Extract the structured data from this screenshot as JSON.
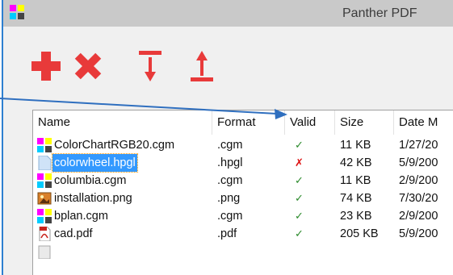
{
  "window": {
    "title": "Panther PDF"
  },
  "toolbar": {
    "buttons": [
      {
        "name": "add",
        "icon": "plus-icon"
      },
      {
        "name": "delete",
        "icon": "x-icon"
      },
      {
        "name": "move-bottom",
        "icon": "arrow-down-to-line-icon"
      },
      {
        "name": "move-top",
        "icon": "arrow-up-from-line-icon"
      }
    ],
    "accent_color": "#e83a3a"
  },
  "table": {
    "columns": [
      "Name",
      "Format",
      "Valid",
      "Size",
      "Date M"
    ],
    "rows": [
      {
        "name": "ColorChartRGB20.cgm",
        "format": ".cgm",
        "valid": "✓",
        "size": "11 KB",
        "date": "1/27/20",
        "icon": "cgm-file-icon",
        "selected": false
      },
      {
        "name": "colorwheel.hpgl",
        "format": ".hpgl",
        "valid": "✗",
        "size": "42 KB",
        "date": "5/9/200",
        "icon": "hpgl-file-icon",
        "selected": true
      },
      {
        "name": "columbia.cgm",
        "format": ".cgm",
        "valid": "✓",
        "size": "11 KB",
        "date": "2/9/200",
        "icon": "cgm-file-icon",
        "selected": false
      },
      {
        "name": "installation.png",
        "format": ".png",
        "valid": "✓",
        "size": "74 KB",
        "date": "7/30/20",
        "icon": "png-file-icon",
        "selected": false
      },
      {
        "name": "bplan.cgm",
        "format": ".cgm",
        "valid": "✓",
        "size": "23 KB",
        "date": "2/9/200",
        "icon": "cgm-file-icon",
        "selected": false
      },
      {
        "name": "cad.pdf",
        "format": ".pdf",
        "valid": "✓",
        "size": "205 KB",
        "date": "5/9/200",
        "icon": "pdf-file-icon",
        "selected": false
      }
    ]
  },
  "colors": {
    "valid": "#2b8a2b",
    "invalid": "#dd1111",
    "selection": "#3399ff",
    "callout": "#2f6fbf"
  }
}
